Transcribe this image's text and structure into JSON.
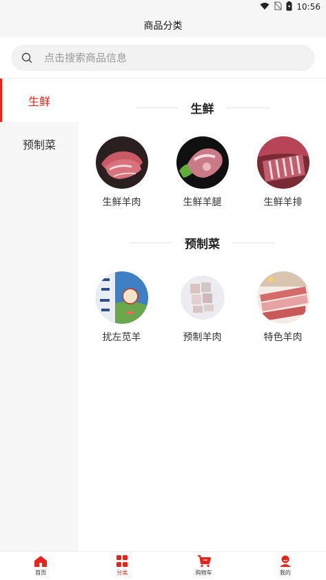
{
  "status": {
    "time": "10:56"
  },
  "header": {
    "title": "商品分类"
  },
  "search": {
    "placeholder": "点击搜索商品信息"
  },
  "sidebar": {
    "items": [
      {
        "label": "生鲜",
        "active": true
      },
      {
        "label": "预制菜",
        "active": false
      }
    ]
  },
  "sections": [
    {
      "title": "生鲜",
      "items": [
        {
          "label": "生鲜羊肉"
        },
        {
          "label": "生鲜羊腿"
        },
        {
          "label": "生鲜羊排"
        }
      ]
    },
    {
      "title": "预制菜",
      "items": [
        {
          "label": "扰左苋羊"
        },
        {
          "label": "预制羊肉"
        },
        {
          "label": "特色羊肉"
        }
      ]
    }
  ],
  "tabbar": {
    "items": [
      {
        "label": "首页",
        "icon": "home-icon"
      },
      {
        "label": "分类",
        "icon": "category-icon",
        "active": true
      },
      {
        "label": "购物车",
        "icon": "cart-icon"
      },
      {
        "label": "我的",
        "icon": "profile-icon"
      }
    ]
  },
  "colors": {
    "accent": "#e8231a",
    "sidebar_bg": "#f7f7f7"
  }
}
